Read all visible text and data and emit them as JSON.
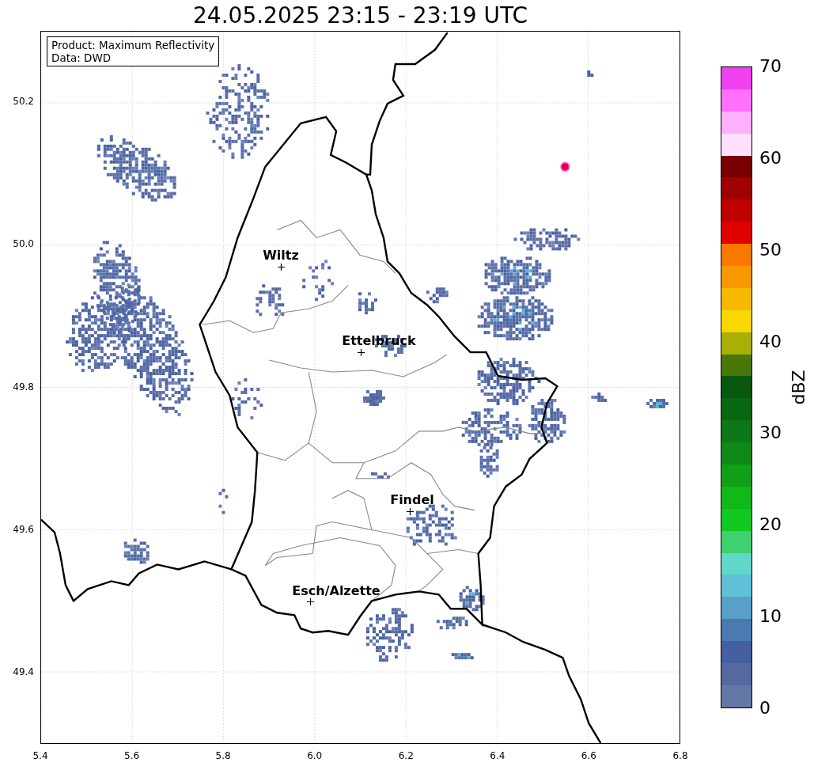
{
  "title": "24.05.2025 23:15 - 23:19 UTC",
  "info_box": {
    "lines": [
      "Product: Maximum Reflectivity",
      "Data: DWD"
    ]
  },
  "map": {
    "xticks": [
      "5.4",
      "5.6",
      "5.8",
      "6.0",
      "6.2",
      "6.4",
      "6.6",
      "6.8"
    ],
    "yticks": [
      "50.2",
      "50.0",
      "49.8",
      "49.6",
      "49.4"
    ],
    "places": [
      {
        "name": "Wiltz"
      },
      {
        "name": "Ettelbruck"
      },
      {
        "name": "Findel"
      },
      {
        "name": "Esch/Alzette"
      }
    ]
  },
  "colorbar": {
    "label": "dBZ",
    "ticks": [
      "70",
      "60",
      "50",
      "40",
      "30",
      "20",
      "10",
      "0"
    ],
    "bands": [
      {
        "color": "#f040f0"
      },
      {
        "color": "#ff70ff"
      },
      {
        "color": "#ffb0ff"
      },
      {
        "color": "#ffe0ff"
      },
      {
        "color": "#780000"
      },
      {
        "color": "#a00000"
      },
      {
        "color": "#c00000"
      },
      {
        "color": "#e00000"
      },
      {
        "color": "#f87800"
      },
      {
        "color": "#f89800"
      },
      {
        "color": "#f8b800"
      },
      {
        "color": "#f8d800"
      },
      {
        "color": "#a8b008"
      },
      {
        "color": "#4a7808"
      },
      {
        "color": "#085810"
      },
      {
        "color": "#086810"
      },
      {
        "color": "#0c7818"
      },
      {
        "color": "#108818"
      },
      {
        "color": "#10a018"
      },
      {
        "color": "#10b818"
      },
      {
        "color": "#10c820"
      },
      {
        "color": "#40d070"
      },
      {
        "color": "#60d8c8"
      },
      {
        "color": "#60c0d8"
      },
      {
        "color": "#58a0c8"
      },
      {
        "color": "#4a7ab0"
      },
      {
        "color": "#4560a0"
      },
      {
        "color": "#5668a0"
      },
      {
        "color": "#6478a8"
      }
    ]
  }
}
